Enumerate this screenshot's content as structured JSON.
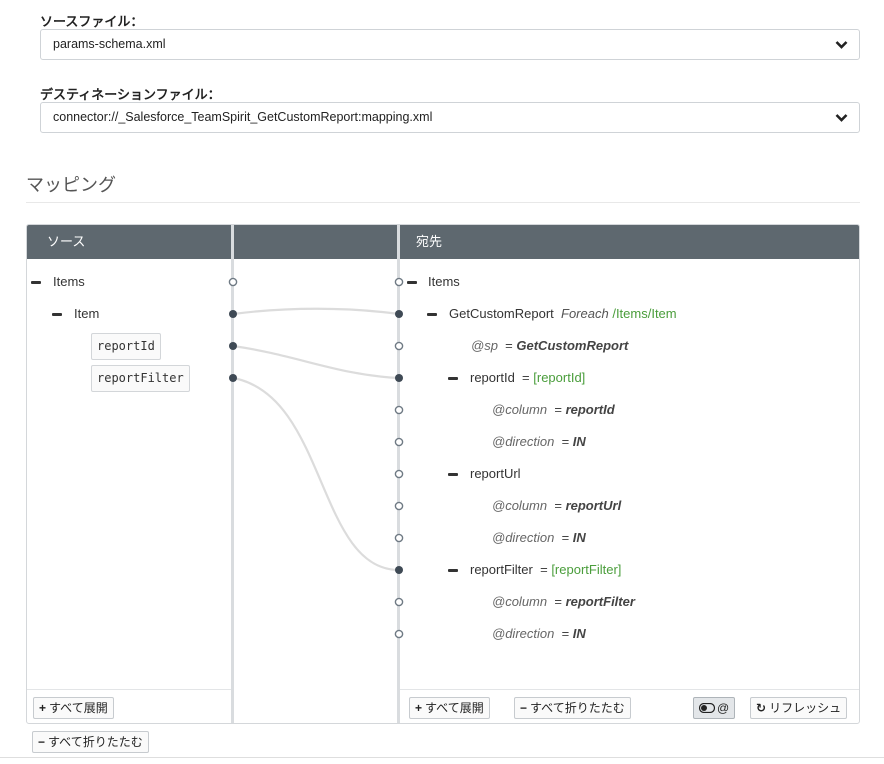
{
  "source_file": {
    "label": "ソースファイル：",
    "value": "params-schema.xml"
  },
  "destination_file": {
    "label": "デスティネーションファイル：",
    "value": "connector://_Salesforce_TeamSpirit_GetCustomReport:mapping.xml"
  },
  "mapping": {
    "title": "マッピング",
    "source_header": "ソース",
    "dest_header": "宛先",
    "source_tree": {
      "root": "Items",
      "child": "Item",
      "leaves": [
        "reportId",
        "reportFilter"
      ]
    },
    "dest_tree": {
      "root": "Items",
      "get_custom_report": {
        "name": "GetCustomReport",
        "foreach_label": "Foreach",
        "foreach_path": "/Items/Item"
      },
      "sp_attr": {
        "name": "@sp",
        "eq": "=",
        "value": "GetCustomReport"
      },
      "report_id": {
        "name": "reportId",
        "eq": "=",
        "mapped": "[reportId]"
      },
      "report_id_column": {
        "name": "@column",
        "eq": "=",
        "value": "reportId"
      },
      "report_id_direction": {
        "name": "@direction",
        "eq": "=",
        "value": "IN"
      },
      "report_url": {
        "name": "reportUrl"
      },
      "report_url_column": {
        "name": "@column",
        "eq": "=",
        "value": "reportUrl"
      },
      "report_url_direction": {
        "name": "@direction",
        "eq": "=",
        "value": "IN"
      },
      "report_filter": {
        "name": "reportFilter",
        "eq": "=",
        "mapped": "[reportFilter]"
      },
      "report_filter_column": {
        "name": "@column",
        "eq": "=",
        "value": "reportFilter"
      },
      "report_filter_direction": {
        "name": "@direction",
        "eq": "=",
        "value": "IN"
      }
    },
    "buttons": {
      "expand_all": "すべて展開",
      "collapse_all": "すべて折りたたむ",
      "toggle_attrs": "@",
      "refresh": "リフレッシュ"
    }
  },
  "colors": {
    "header_bg": "#5e686f",
    "mapped_value": "#4a9d3b",
    "connector_line": "#dcdcdc",
    "node_dot": "#3f4a55"
  },
  "icons": [
    "chevron-down-icon",
    "minus-icon",
    "plus-icon",
    "toggle-icon",
    "refresh-icon"
  ]
}
